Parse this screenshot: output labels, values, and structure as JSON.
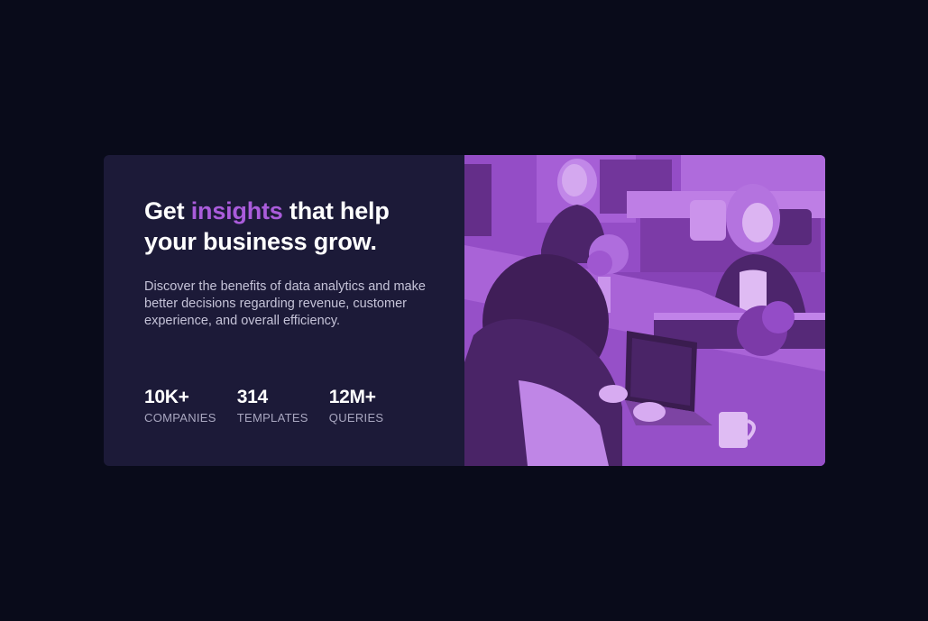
{
  "card": {
    "headline_start": "Get ",
    "headline_accent": "insights",
    "headline_end": " that help your business grow.",
    "description": "Discover the benefits of data analytics and make better decisions regarding revenue, customer experience, and overall efficiency."
  },
  "stats": [
    {
      "value": "10K+",
      "label": "COMPANIES"
    },
    {
      "value": "314",
      "label": "TEMPLATES"
    },
    {
      "value": "12M+",
      "label": "QUERIES"
    }
  ],
  "colors": {
    "page_background": "#090b1a",
    "card_background": "#1c1a38",
    "accent": "#aa5cdb",
    "image_overlay": "#aa5cdb"
  },
  "image": {
    "subject": "people-working-at-desks-photo"
  }
}
